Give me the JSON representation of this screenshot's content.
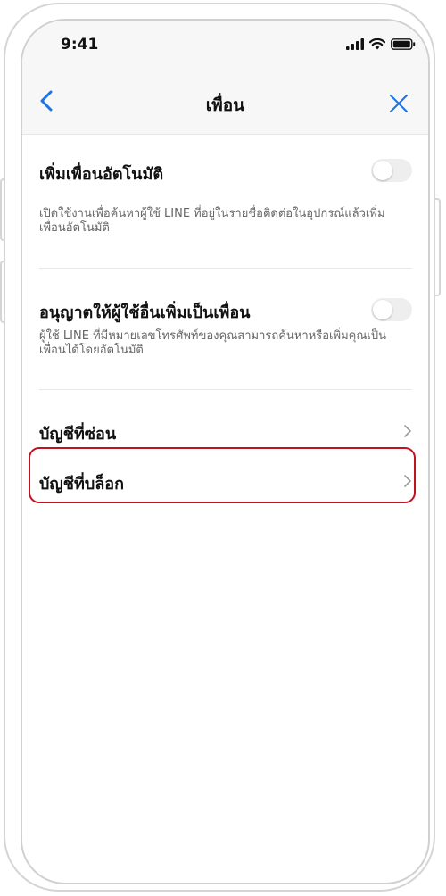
{
  "status_bar": {
    "time": "9:41",
    "icons": [
      "cellular-signal-icon",
      "wifi-icon",
      "battery-icon"
    ]
  },
  "nav": {
    "title": "เพื่อน",
    "back_icon": "chevron-left-icon",
    "close_icon": "close-icon"
  },
  "settings": {
    "auto_add": {
      "title": "เพิ่มเพื่อนอัตโนมัติ",
      "description": "เปิดใช้งานเพื่อค้นหาผู้ใช้ LINE ที่อยู่ในรายชื่อติดต่อในอุปกรณ์แล้วเพิ่มเพื่อนอัตโนมัติ",
      "enabled": false
    },
    "allow_others": {
      "title": "อนุญาตให้ผู้ใช้อื่นเพิ่มเป็นเพื่อน",
      "description": "ผู้ใช้ LINE ที่มีหมายเลขโทรศัพท์ของคุณสามารถค้นหาหรือเพิ่มคุณเป็นเพื่อนได้โดยอัตโนมัติ",
      "enabled": false
    }
  },
  "list": {
    "hidden_accounts": "บัญชีที่ซ่อน",
    "blocked_accounts": "บัญชีที่บล็อก"
  },
  "colors": {
    "accent_blue": "#1a73e8",
    "highlight_red": "#c1121f",
    "toggle_off": "#eeeeee"
  }
}
